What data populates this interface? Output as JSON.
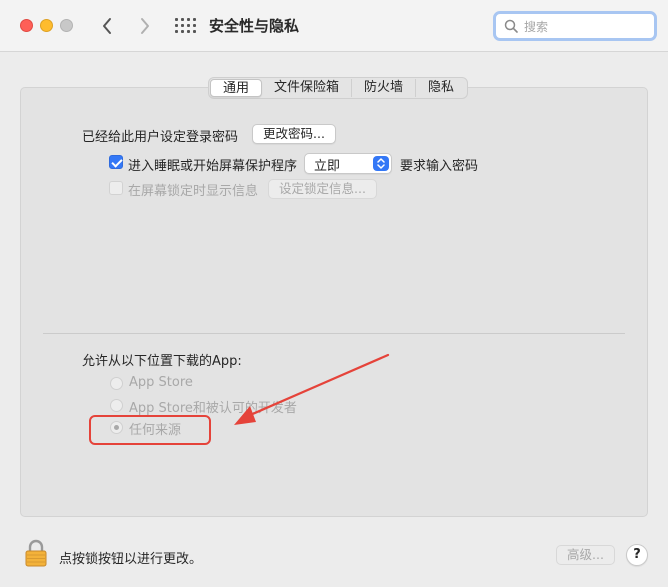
{
  "window": {
    "title": "安全性与隐私"
  },
  "search": {
    "placeholder": "搜索",
    "value": ""
  },
  "tabs": [
    {
      "label": "通用",
      "active": true
    },
    {
      "label": "文件保险箱",
      "active": false
    },
    {
      "label": "防火墙",
      "active": false
    },
    {
      "label": "隐私",
      "active": false
    }
  ],
  "general": {
    "password_label": "已经给此用户设定登录密码",
    "change_password_button": "更改密码...",
    "require_password": {
      "checked": true,
      "label": "进入睡眠或开始屏幕保护程序",
      "delay_value": "立即",
      "suffix": "要求输入密码"
    },
    "lock_message": {
      "checked": false,
      "disabled": true,
      "label": "在屏幕锁定时显示信息",
      "button": "设定锁定信息..."
    }
  },
  "download_source": {
    "heading": "允许从以下位置下载的App:",
    "options": [
      {
        "label": "App Store",
        "selected": false
      },
      {
        "label": "App Store和被认可的开发者",
        "selected": false
      },
      {
        "label": "任何来源",
        "selected": true
      }
    ]
  },
  "bottom": {
    "lock_text": "点按锁按钮以进行更改。",
    "advanced_button": "高级...",
    "help_button": "?"
  },
  "colors": {
    "accent": "#3478f6",
    "annotation": "#e5433a"
  },
  "icons": [
    "back-icon",
    "forward-icon",
    "grid-icon",
    "search-icon",
    "lock-icon",
    "help-icon"
  ]
}
